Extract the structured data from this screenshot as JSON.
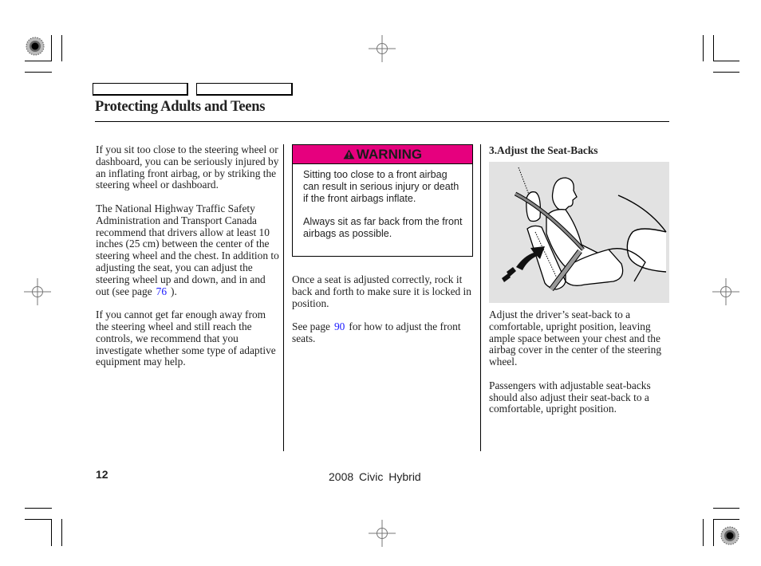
{
  "header": {
    "section_title": "Protecting Adults and Teens",
    "tab_boxes": [
      "",
      ""
    ]
  },
  "column1": {
    "paragraphs": [
      "If you sit too close to the steering wheel or dashboard, you can be seriously injured by an inflating front airbag, or by striking the steering wheel or dashboard.",
      "The National Highway Traffic Safety Administration and Transport Canada recommend that drivers allow at least 10 inches (25 cm) between the center of the steering wheel and the chest. In addition to adjusting the seat, you can adjust the steering wheel up and down, and in and out (see page",
      "If you cannot get far enough away from the steering wheel and still reach the controls, we recommend that you investigate whether some type of adaptive equipment may help."
    ],
    "p2_link": "76",
    "p2_suffix": ")."
  },
  "column2": {
    "warning": {
      "label": "WARNING",
      "icon": "warning-triangle-icon",
      "color": "#e6007e",
      "paragraphs": [
        "Sitting too close to a front airbag can result in serious injury or death if the front airbags inflate.",
        "Always sit as far back from the front airbags as possible."
      ]
    },
    "p1": "Once a seat is adjusted correctly, rock it back and forth to make sure it is locked in position.",
    "p2_prefix": "See page",
    "p2_link": "90",
    "p2_suffix": "for how to adjust the front seats."
  },
  "column3": {
    "heading": "3.Adjust the Seat-Backs",
    "illustration": "driver-seat-back-adjustment-illustration",
    "paragraphs": [
      "Adjust the driver’s seat-back to a comfortable, upright position, leaving ample space between your chest and the airbag cover in the center of the steering wheel.",
      "Passengers with adjustable seat-backs should also adjust their seat-back to a comfortable, upright position."
    ]
  },
  "footer": {
    "page_number": "12",
    "model": "2008  Civic  Hybrid"
  },
  "colors": {
    "link": "#1a1aff",
    "warning_header": "#e6007e",
    "illustration_bg": "#e2e2e2"
  }
}
